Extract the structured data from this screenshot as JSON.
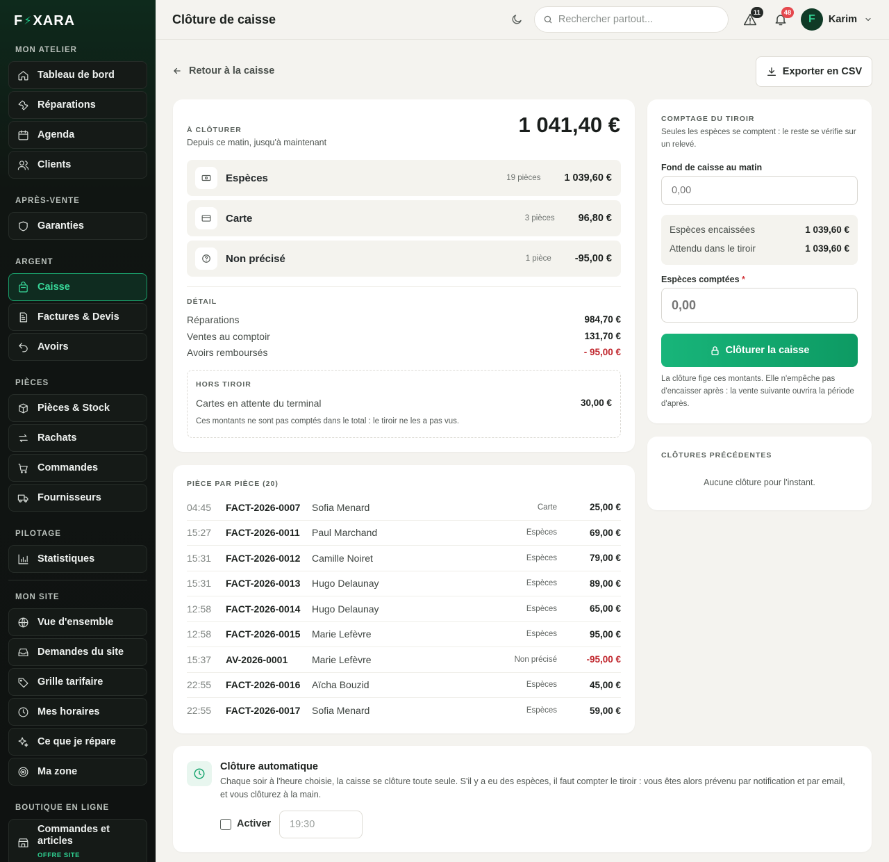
{
  "brand": {
    "logo_left": "F",
    "logo_bolt": "⚡",
    "logo_right": "XARA"
  },
  "colors": {
    "accent": "#1fc98a",
    "negative": "#c0262d",
    "sidebar_bg": "#0f1211"
  },
  "sidebar": {
    "sections": {
      "atelier": "MON ATELIER",
      "apres_vente": "APRÈS-VENTE",
      "argent": "ARGENT",
      "pieces": "PIÈCES",
      "pilotage": "PILOTAGE",
      "site": "MON SITE",
      "boutique": "BOUTIQUE EN LIGNE"
    },
    "items": {
      "dashboard": "Tableau de bord",
      "repairs": "Réparations",
      "agenda": "Agenda",
      "clients": "Clients",
      "warranties": "Garanties",
      "cashier": "Caisse",
      "invoices": "Factures & Devis",
      "credits": "Avoirs",
      "stock": "Pièces & Stock",
      "buybacks": "Rachats",
      "orders": "Commandes",
      "suppliers": "Fournisseurs",
      "stats": "Statistiques",
      "overview": "Vue d'ensemble",
      "site_requests": "Demandes du site",
      "pricing": "Grille tarifaire",
      "hours": "Mes horaires",
      "what_i_repair": "Ce que je répare",
      "zone": "Ma zone",
      "shop_orders": "Commandes et articles",
      "shop_orders_tag": "OFFRE SITE"
    }
  },
  "topbar": {
    "title": "Clôture de caisse",
    "search_placeholder": "Rechercher partout...",
    "alerts_count": "11",
    "notifications_count": "48",
    "user_initial": "F",
    "user_name": "Karim"
  },
  "toolbar": {
    "back_label": "Retour à la caisse",
    "export_label": "Exporter en CSV"
  },
  "summary": {
    "label": "À CLÔTURER",
    "subtitle": "Depuis ce matin, jusqu'à maintenant",
    "total": "1 041,40 €",
    "methods": [
      {
        "name": "Espèces",
        "count": "19 pièces",
        "amount": "1 039,60 €"
      },
      {
        "name": "Carte",
        "count": "3 pièces",
        "amount": "96,80 €"
      },
      {
        "name": "Non précisé",
        "count": "1 pièce",
        "amount": "-95,00 €"
      }
    ],
    "detail_label": "DÉTAIL",
    "detail": [
      {
        "label": "Réparations",
        "value": "984,70 €"
      },
      {
        "label": "Ventes au comptoir",
        "value": "131,70 €"
      },
      {
        "label": "Avoirs remboursés",
        "value": "- 95,00 €"
      }
    ],
    "off_drawer": {
      "label": "HORS TIROIR",
      "line_label": "Cartes en attente du terminal",
      "line_value": "30,00 €",
      "note": "Ces montants ne sont pas comptés dans le total : le tiroir ne les a pas vus."
    }
  },
  "pieces": {
    "label": "PIÈCE PAR PIÈCE (20)",
    "rows": [
      {
        "time": "04:45",
        "ref": "FACT-2026-0007",
        "client": "Sofia Menard",
        "method": "Carte",
        "amount": "25,00 €"
      },
      {
        "time": "15:27",
        "ref": "FACT-2026-0011",
        "client": "Paul Marchand",
        "method": "Espèces",
        "amount": "69,00 €"
      },
      {
        "time": "15:31",
        "ref": "FACT-2026-0012",
        "client": "Camille Noiret",
        "method": "Espèces",
        "amount": "79,00 €"
      },
      {
        "time": "15:31",
        "ref": "FACT-2026-0013",
        "client": "Hugo Delaunay",
        "method": "Espèces",
        "amount": "89,00 €"
      },
      {
        "time": "12:58",
        "ref": "FACT-2026-0014",
        "client": "Hugo Delaunay",
        "method": "Espèces",
        "amount": "65,00 €"
      },
      {
        "time": "12:58",
        "ref": "FACT-2026-0015",
        "client": "Marie Lefèvre",
        "method": "Espèces",
        "amount": "95,00 €"
      },
      {
        "time": "15:37",
        "ref": "AV-2026-0001",
        "client": "Marie Lefèvre",
        "method": "Non précisé",
        "amount": "-95,00 €"
      },
      {
        "time": "22:55",
        "ref": "FACT-2026-0016",
        "client": "Aïcha Bouzid",
        "method": "Espèces",
        "amount": "45,00 €"
      },
      {
        "time": "22:55",
        "ref": "FACT-2026-0017",
        "client": "Sofia Menard",
        "method": "Espèces",
        "amount": "59,00 €"
      }
    ]
  },
  "drawer": {
    "label": "COMPTAGE DU TIROIR",
    "hint": "Seules les espèces se comptent : le reste se vérifie sur un relevé.",
    "float_label": "Fond de caisse au matin",
    "float_placeholder": "0,00",
    "cash_in_label": "Espèces encaissées",
    "cash_in_value": "1 039,60 €",
    "expected_label": "Attendu dans le tiroir",
    "expected_value": "1 039,60 €",
    "counted_label": "Espèces comptées",
    "required_mark": "*",
    "counted_placeholder": "0,00",
    "close_button": "Clôturer la caisse",
    "close_note": "La clôture fige ces montants. Elle n'empêche pas d'encaisser après : la vente suivante ouvrira la période d'après."
  },
  "previous": {
    "label": "CLÔTURES PRÉCÉDENTES",
    "empty": "Aucune clôture pour l'instant."
  },
  "auto_close": {
    "title": "Clôture automatique",
    "description": "Chaque soir à l'heure choisie, la caisse se clôture toute seule. S'il y a eu des espèces, il faut compter le tiroir : vous êtes alors prévenu par notification et par email, et vous clôturez à la main.",
    "enable_label": "Activer",
    "time_placeholder": "19:30"
  }
}
